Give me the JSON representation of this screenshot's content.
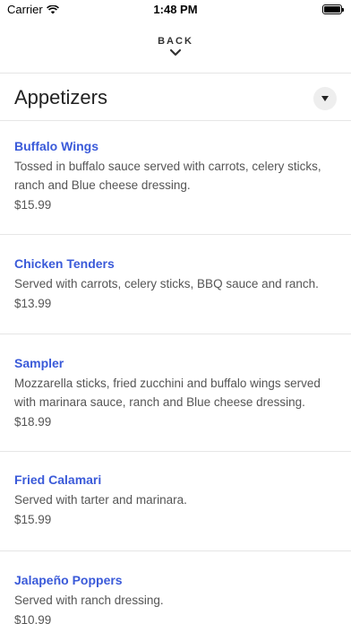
{
  "status_bar": {
    "carrier": "Carrier",
    "time": "1:48 PM"
  },
  "nav": {
    "back_label": "BACK"
  },
  "section": {
    "title": "Appetizers"
  },
  "items": [
    {
      "name": "Buffalo Wings",
      "description": "Tossed in buffalo sauce served with carrots, celery sticks, ranch and Blue cheese dressing.",
      "price": "$15.99"
    },
    {
      "name": "Chicken Tenders",
      "description": "Served with carrots, celery sticks, BBQ sauce and ranch.",
      "price": "$13.99"
    },
    {
      "name": "Sampler",
      "description": "Mozzarella sticks, fried zucchini and buffalo wings served with marinara sauce, ranch and Blue cheese dressing.",
      "price": "$18.99"
    },
    {
      "name": "Fried Calamari",
      "description": "Served with tarter and marinara.",
      "price": "$15.99"
    },
    {
      "name": "Jalapeño Poppers",
      "description": "Served with ranch dressing.",
      "price": "$10.99"
    }
  ],
  "colors": {
    "item_name": "#3a5ad9",
    "divider": "#e6e6e6",
    "text_muted": "#555555"
  }
}
